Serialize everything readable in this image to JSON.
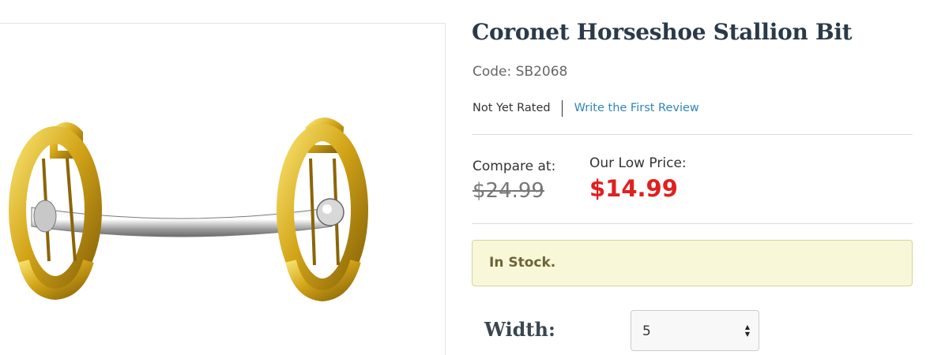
{
  "product": {
    "title": "Coronet Horseshoe Stallion Bit",
    "code": "Code: SB2068",
    "rating_status": "Not Yet Rated",
    "review_link": "Write the First Review",
    "compare_label": "Compare at:",
    "compare_price": "$24.99",
    "low_price_label": "Our Low Price:",
    "low_price": "$14.99",
    "stock_status": "In Stock.",
    "option_label": "Width:",
    "option_value": "5"
  },
  "colors": {
    "title": "#2b3a48",
    "sale_price": "#e02020",
    "link": "#2e86b8",
    "stock_bg": "#f8f7d8",
    "stock_border": "#dcd396"
  },
  "icons": {
    "select_arrows": "up-down-arrows-icon"
  }
}
